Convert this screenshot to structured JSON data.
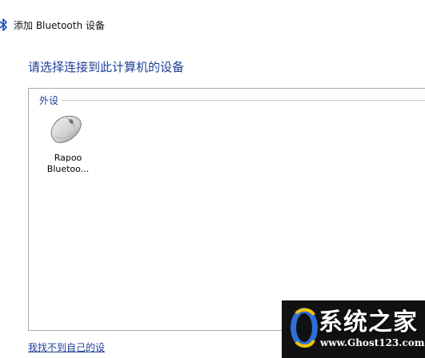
{
  "window": {
    "title": "添加 Bluetooth 设备"
  },
  "main": {
    "heading": "请选择连接到此计算机的设备",
    "group_label": "外设",
    "devices": [
      {
        "name": "Rapoo",
        "subname": "Bluetoo...",
        "icon": "mouse-icon"
      }
    ],
    "help_link": "我找不到自己的设"
  },
  "watermark": {
    "title": "系统之家",
    "url": "www.Ghost123.com"
  },
  "colors": {
    "accent": "#1f3f97",
    "border": "#a9a9a9",
    "watermark_bg": "#111111"
  }
}
